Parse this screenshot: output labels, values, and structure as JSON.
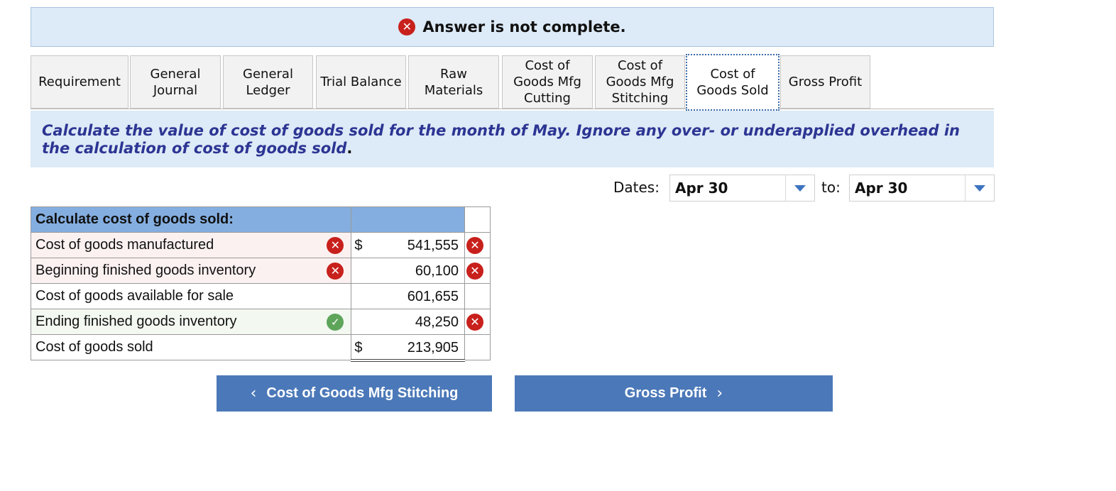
{
  "banner": {
    "message": "Answer is not complete.",
    "icon": "x-circle-icon",
    "status_color": "#c8201c"
  },
  "tabs": [
    {
      "label": "Requirement"
    },
    {
      "label": "General\nJournal"
    },
    {
      "label": "General\nLedger"
    },
    {
      "label": "Trial Balance"
    },
    {
      "label": "Raw\nMaterials"
    },
    {
      "label": "Cost of\nGoods Mfg\nCutting"
    },
    {
      "label": "Cost of\nGoods Mfg\nStitching"
    },
    {
      "label": "Cost of\nGoods Sold"
    },
    {
      "label": "Gross Profit"
    }
  ],
  "active_tab": "Cost of Goods Sold",
  "instructions": {
    "text": "Calculate the value of cost of goods sold for the month of May. Ignore any over- or underapplied overhead in the calculation of cost of goods sold",
    "period": "."
  },
  "dates": {
    "label": "Dates:",
    "from_value": "Apr 30",
    "to_label": "to:",
    "to_value": "Apr 30"
  },
  "table": {
    "header": "Calculate cost of goods sold:",
    "rows": [
      {
        "label": "Cost of goods manufactured",
        "currency": "$",
        "amount": "541,555",
        "label_status": "incorrect",
        "amount_status": "incorrect"
      },
      {
        "label": "Beginning finished goods inventory",
        "currency": "",
        "amount": "60,100",
        "label_status": "incorrect",
        "amount_status": "incorrect"
      },
      {
        "label": "Cost of goods available for sale",
        "currency": "",
        "amount": "601,655",
        "label_status": "none",
        "amount_status": "none"
      },
      {
        "label": "Ending finished goods inventory",
        "currency": "",
        "amount": "48,250",
        "label_status": "correct",
        "amount_status": "incorrect"
      },
      {
        "label": "Cost of goods sold",
        "currency": "$",
        "amount": "213,905",
        "label_status": "none",
        "amount_status": "none"
      }
    ]
  },
  "nav": {
    "prev_label": "Cost of Goods Mfg Stitching",
    "next_label": "Gross Profit"
  },
  "colors": {
    "accent": "#4b78b8",
    "header_blue": "#84aee0",
    "instruction_text": "#2c3593",
    "correct": "#5ea55a",
    "incorrect": "#c8201c"
  }
}
